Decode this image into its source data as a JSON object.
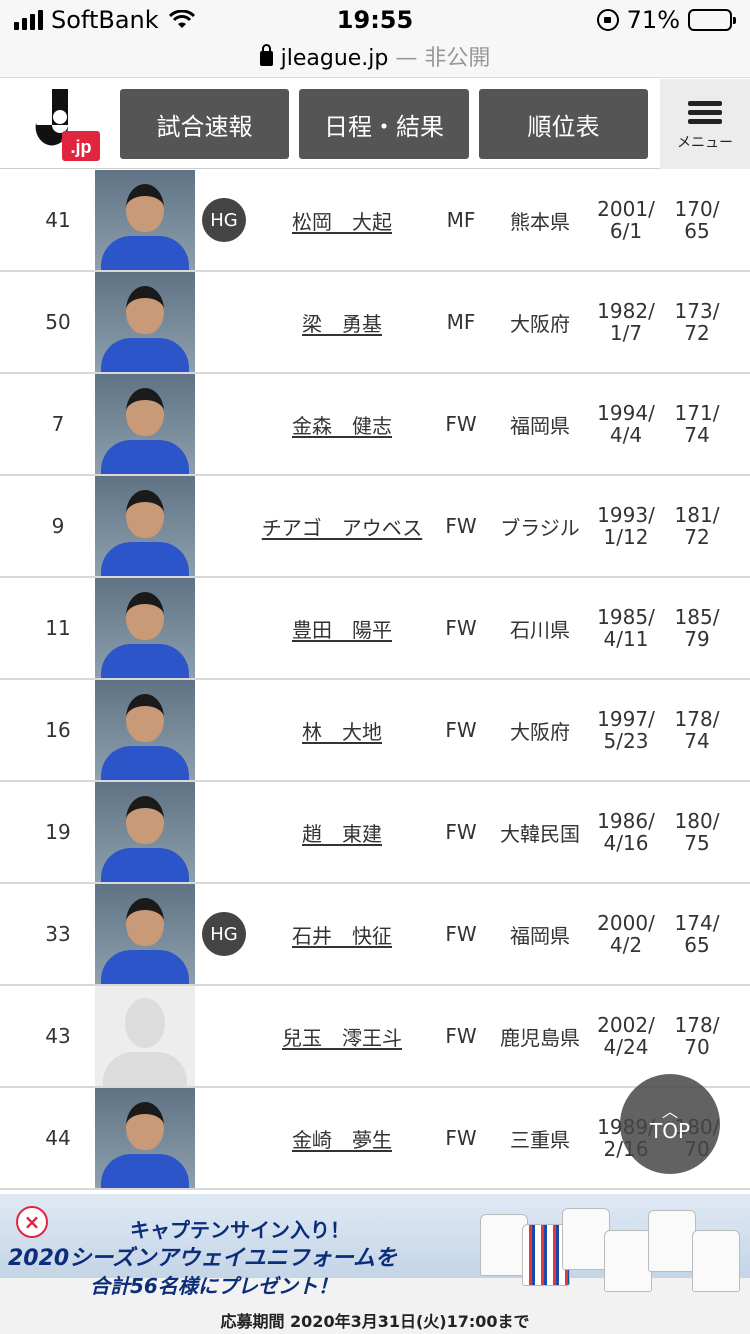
{
  "status_bar": {
    "carrier": "SoftBank",
    "time": "19:55",
    "battery": "71%",
    "battery_level": 0.71,
    "url": "jleague.jp",
    "private_label": "— 非公開"
  },
  "header": {
    "logo": "J.jp",
    "nav": [
      "試合速報",
      "日程・結果",
      "順位表"
    ],
    "menu_label": "メニュー"
  },
  "players": [
    {
      "no": "41",
      "hg": "HG",
      "name": "松岡　大起",
      "pos": "MF",
      "origin": "熊本県",
      "dob1": "2001/",
      "dob2": "6/1",
      "h": "170/",
      "w": "65",
      "photo": "real"
    },
    {
      "no": "50",
      "hg": "",
      "name": "梁　勇基",
      "pos": "MF",
      "origin": "大阪府",
      "dob1": "1982/",
      "dob2": "1/7",
      "h": "173/",
      "w": "72",
      "photo": "real"
    },
    {
      "no": "7",
      "hg": "",
      "name": "金森　健志",
      "pos": "FW",
      "origin": "福岡県",
      "dob1": "1994/",
      "dob2": "4/4",
      "h": "171/",
      "w": "74",
      "photo": "real"
    },
    {
      "no": "9",
      "hg": "",
      "name": "チアゴ　アウベス",
      "pos": "FW",
      "origin": "ブラジル",
      "dob1": "1993/",
      "dob2": "1/12",
      "h": "181/",
      "w": "72",
      "photo": "real"
    },
    {
      "no": "11",
      "hg": "",
      "name": "豊田　陽平",
      "pos": "FW",
      "origin": "石川県",
      "dob1": "1985/",
      "dob2": "4/11",
      "h": "185/",
      "w": "79",
      "photo": "real"
    },
    {
      "no": "16",
      "hg": "",
      "name": "林　大地",
      "pos": "FW",
      "origin": "大阪府",
      "dob1": "1997/",
      "dob2": "5/23",
      "h": "178/",
      "w": "74",
      "photo": "real"
    },
    {
      "no": "19",
      "hg": "",
      "name": "趙　東建",
      "pos": "FW",
      "origin": "大韓民国",
      "dob1": "1986/",
      "dob2": "4/16",
      "h": "180/",
      "w": "75",
      "photo": "real"
    },
    {
      "no": "33",
      "hg": "HG",
      "name": "石井　快征",
      "pos": "FW",
      "origin": "福岡県",
      "dob1": "2000/",
      "dob2": "4/2",
      "h": "174/",
      "w": "65",
      "photo": "real"
    },
    {
      "no": "43",
      "hg": "",
      "name": "兒玉　澪王斗",
      "pos": "FW",
      "origin": "鹿児島県",
      "dob1": "2002/",
      "dob2": "4/24",
      "h": "178/",
      "w": "70",
      "photo": "blank"
    },
    {
      "no": "44",
      "hg": "",
      "name": "金崎　夢生",
      "pos": "FW",
      "origin": "三重県",
      "dob1": "1989/",
      "dob2": "2/16",
      "h": "180/",
      "w": "70",
      "photo": "real"
    }
  ],
  "top_button": "TOP",
  "banner": {
    "line1": "キャプテンサイン入り！",
    "line2": "2020シーズンアウェイユニフォームを",
    "line3": "合計56名様にプレゼント！",
    "period": "応募期間 2020年3月31日(火)17:00まで",
    "close": "×"
  },
  "colors": {
    "nav_bg": "#555555",
    "hg_badge": "#444444",
    "logo_red": "#e0263e",
    "banner_text": "#0b2d7a"
  }
}
